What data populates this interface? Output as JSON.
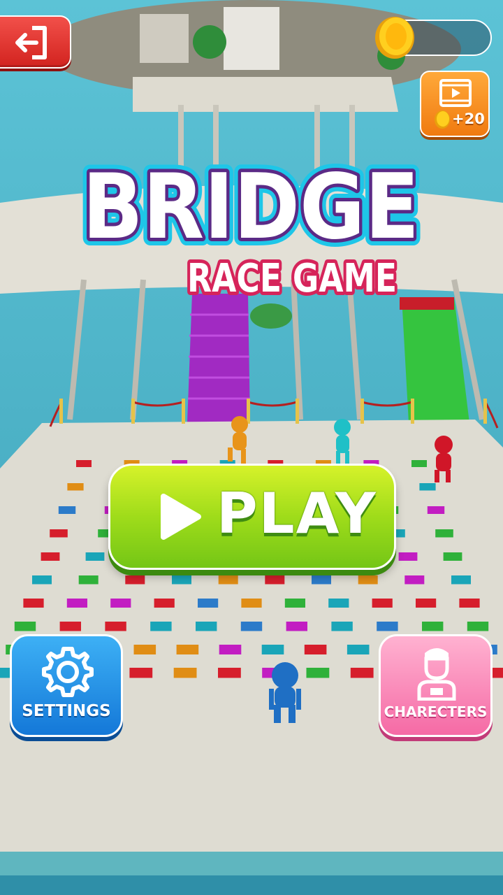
{
  "title": {
    "line1": "BRIDGE",
    "line2": "RACE GAME"
  },
  "hud": {
    "coins": "",
    "exit_icon": "exit-arrow-icon",
    "coin_icon": "gold-coin-icon",
    "video_reward": "+20",
    "video_icon": "video-film-icon"
  },
  "buttons": {
    "play": "PLAY",
    "settings": "SETTINGS",
    "characters": "CHARECTERS"
  },
  "colors": {
    "play": "#9fdc1a",
    "settings": "#1478d8",
    "characters": "#f56aa5",
    "exit": "#d2231f",
    "video": "#f07a10",
    "title_outline": "#5b2a86"
  }
}
